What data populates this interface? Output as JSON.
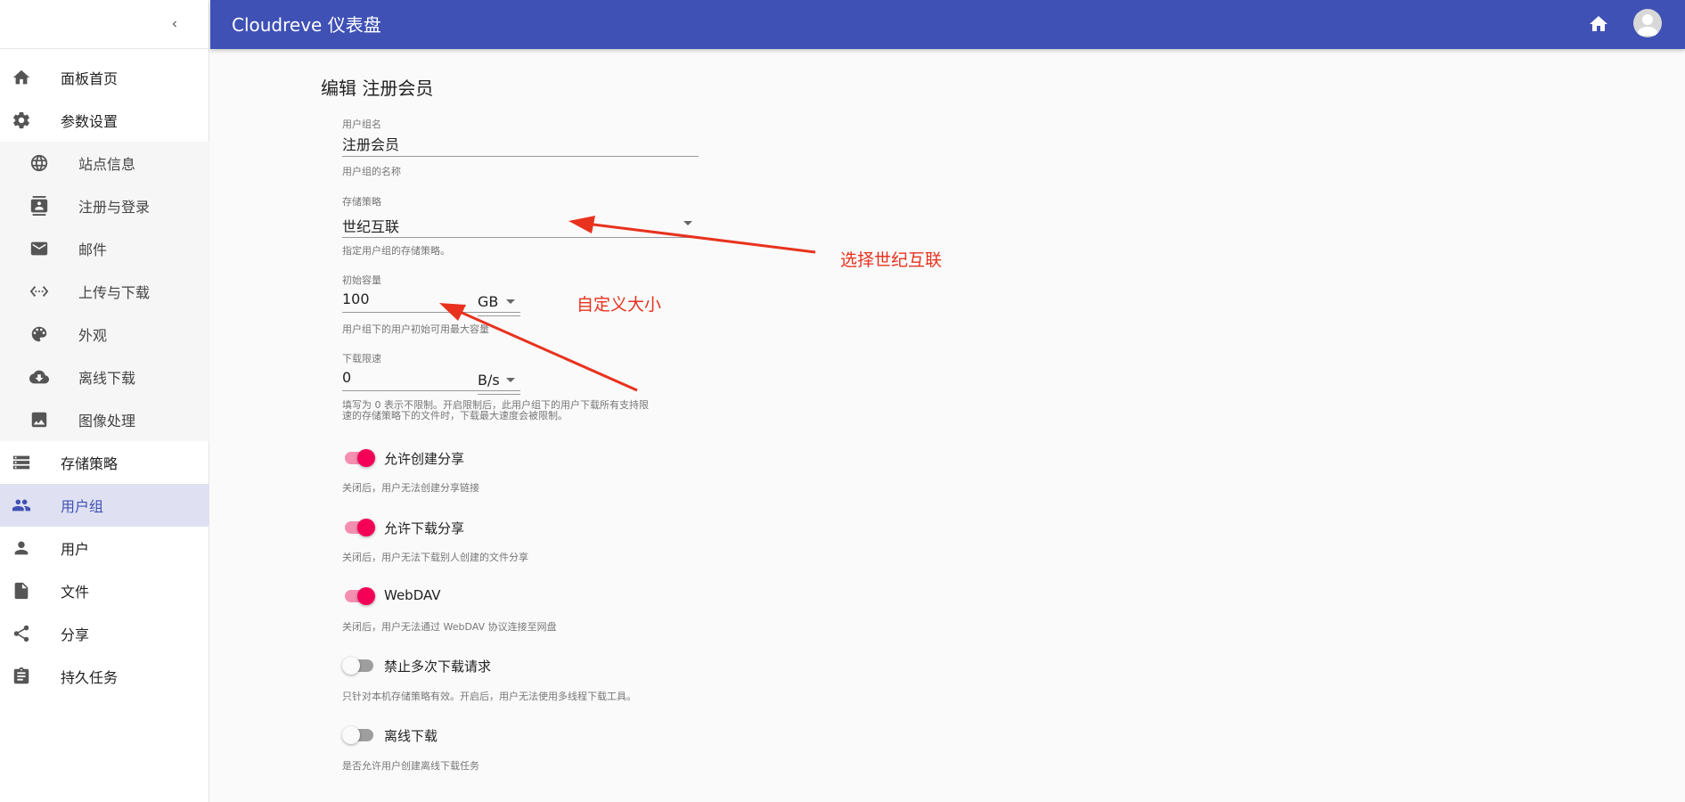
{
  "app": {
    "title": "Cloudreve 仪表盘"
  },
  "sidebar": {
    "items": [
      {
        "label": "面板首页",
        "icon": "home-icon"
      },
      {
        "label": "参数设置",
        "icon": "gear-icon"
      },
      {
        "label": "站点信息",
        "icon": "globe-icon"
      },
      {
        "label": "注册与登录",
        "icon": "contacts-icon"
      },
      {
        "label": "邮件",
        "icon": "mail-icon"
      },
      {
        "label": "上传与下载",
        "icon": "settings-ethernet-icon"
      },
      {
        "label": "外观",
        "icon": "palette-icon"
      },
      {
        "label": "离线下载",
        "icon": "download-cloud-icon"
      },
      {
        "label": "图像处理",
        "icon": "image-icon"
      },
      {
        "label": "存储策略",
        "icon": "storage-icon"
      },
      {
        "label": "用户组",
        "icon": "group-icon"
      },
      {
        "label": "用户",
        "icon": "person-icon"
      },
      {
        "label": "文件",
        "icon": "file-icon"
      },
      {
        "label": "分享",
        "icon": "share-icon"
      },
      {
        "label": "持久任务",
        "icon": "assignment-icon"
      }
    ],
    "active": "用户组"
  },
  "form": {
    "title": "编辑 注册会员",
    "group_name": {
      "label": "用户组名",
      "value": "注册会员",
      "helper": "用户组的名称"
    },
    "policy": {
      "label": "存储策略",
      "value": "世纪互联",
      "helper": "指定用户组的存储策略。"
    },
    "capacity": {
      "label": "初始容量",
      "value": "100",
      "unit": "GB",
      "helper": "用户组下的用户初始可用最大容量"
    },
    "speed": {
      "label": "下载限速",
      "value": "0",
      "unit": "B/s",
      "helper_line1": "填写为 0 表示不限制。开启限制后，此用户组下的用户下载所有支持限",
      "helper_line2": "速的存储策略下的文件时，下载最大速度会被限制。"
    },
    "toggles": [
      {
        "label": "允许创建分享",
        "on": true,
        "helper": "关闭后，用户无法创建分享链接"
      },
      {
        "label": "允许下载分享",
        "on": true,
        "helper": "关闭后，用户无法下载别人创建的文件分享"
      },
      {
        "label": "WebDAV",
        "on": true,
        "helper": "关闭后，用户无法通过 WebDAV 协议连接至网盘"
      },
      {
        "label": "禁止多次下载请求",
        "on": false,
        "helper": "只针对本机存储策略有效。开启后，用户无法使用多线程下载工具。"
      },
      {
        "label": "离线下载",
        "on": false,
        "helper": "是否允许用户创建离线下载任务"
      }
    ]
  },
  "annotations": {
    "policy_note": "选择世纪互联",
    "capacity_note": "自定义大小"
  },
  "colors": {
    "primary": "#3f51b5",
    "switch_on": "#f50057",
    "annotation": "#e8321e"
  }
}
